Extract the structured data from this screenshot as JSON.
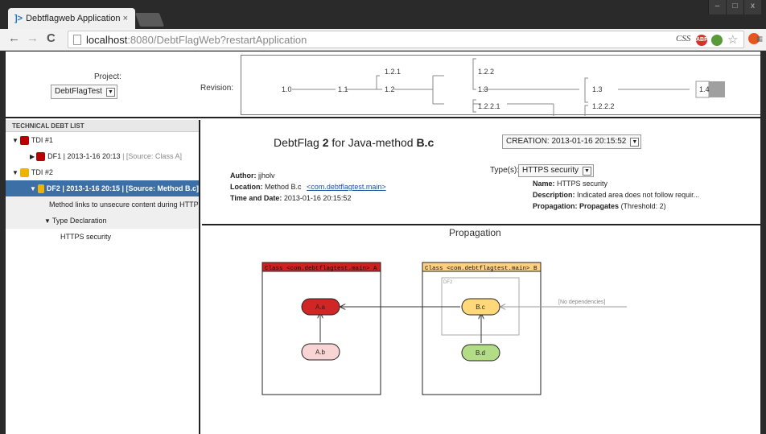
{
  "browser": {
    "tab_title": "Debtflagweb Application",
    "tab_close": "×",
    "url_host": "localhost",
    "url_rest": ":8080/DebtFlagWeb?restartApplication",
    "ext_css": "CSS",
    "ext_abp": "ABP",
    "window_controls": [
      "–",
      "□",
      "x"
    ]
  },
  "header": {
    "project_label": "Project:",
    "project_value": "DebtFlagTest",
    "revision_label": "Revision:",
    "revisions": {
      "r10": "1.0",
      "r11": "1.1",
      "r121": "1.2.1",
      "r12": "1.2",
      "r122": "1.2.2",
      "r13a": "1.3",
      "r1221": "1.2.2.1",
      "r13b": "1.3",
      "r1222": "1.2.2.2",
      "r14": "1.4"
    }
  },
  "technical_debt_list": {
    "header": "TECHNICAL DEBT LIST",
    "items": [
      {
        "label": "TDI #1"
      },
      {
        "label": "DF1 | 2013-1-16 20:13",
        "source": "| [Source: Class A]"
      },
      {
        "label": "TDI #2"
      },
      {
        "label": "DF2 | 2013-1-16 20:15 | [Source: Method B.c]"
      },
      {
        "label": "Method links to unsecure content during HTTPS"
      },
      {
        "label": "Type Declaration"
      },
      {
        "label": "HTTPS security"
      }
    ]
  },
  "details": {
    "title_prefix": "DebtFlag ",
    "title_num": "2",
    "title_mid": " for Java-method ",
    "title_target": "B.c",
    "creation": "CREATION: 2013-01-16 20:15:52",
    "author_label": "Author:",
    "author": "jjholv",
    "location_label": "Location:",
    "location": "Method B.c",
    "location_link": "<com.debtflagtest.main>",
    "time_label": "Time and Date:",
    "time": "2013-01-16 20:15:52",
    "types_label": "Type(s):",
    "types_value": "HTTPS security",
    "name_label": "Name:",
    "name": "HTTPS security",
    "description_label": "Description:",
    "description": "Indicated area does not follow requir...",
    "propagation_label": "Propagation:",
    "propagation_value": "Propagates",
    "threshold": "(Threshold: 2)"
  },
  "propagation": {
    "title": "Propagation",
    "class_a": "Class <com.debtflagtest.main> A",
    "class_b": "Class <com.debtflagtest.main> B",
    "df_label": "DF2",
    "node_aa": "A.a",
    "node_ab": "A.b",
    "node_bc": "B.c",
    "node_bd": "B.d",
    "no_deps": "[No dependencies]",
    "colors": {
      "class_a_header": "#d02020",
      "class_b_header": "#ffd080",
      "node_aa": "#d02626",
      "node_ab": "#f8d4d4",
      "node_bc": "#ffd879",
      "node_bd": "#b3dc87"
    }
  }
}
